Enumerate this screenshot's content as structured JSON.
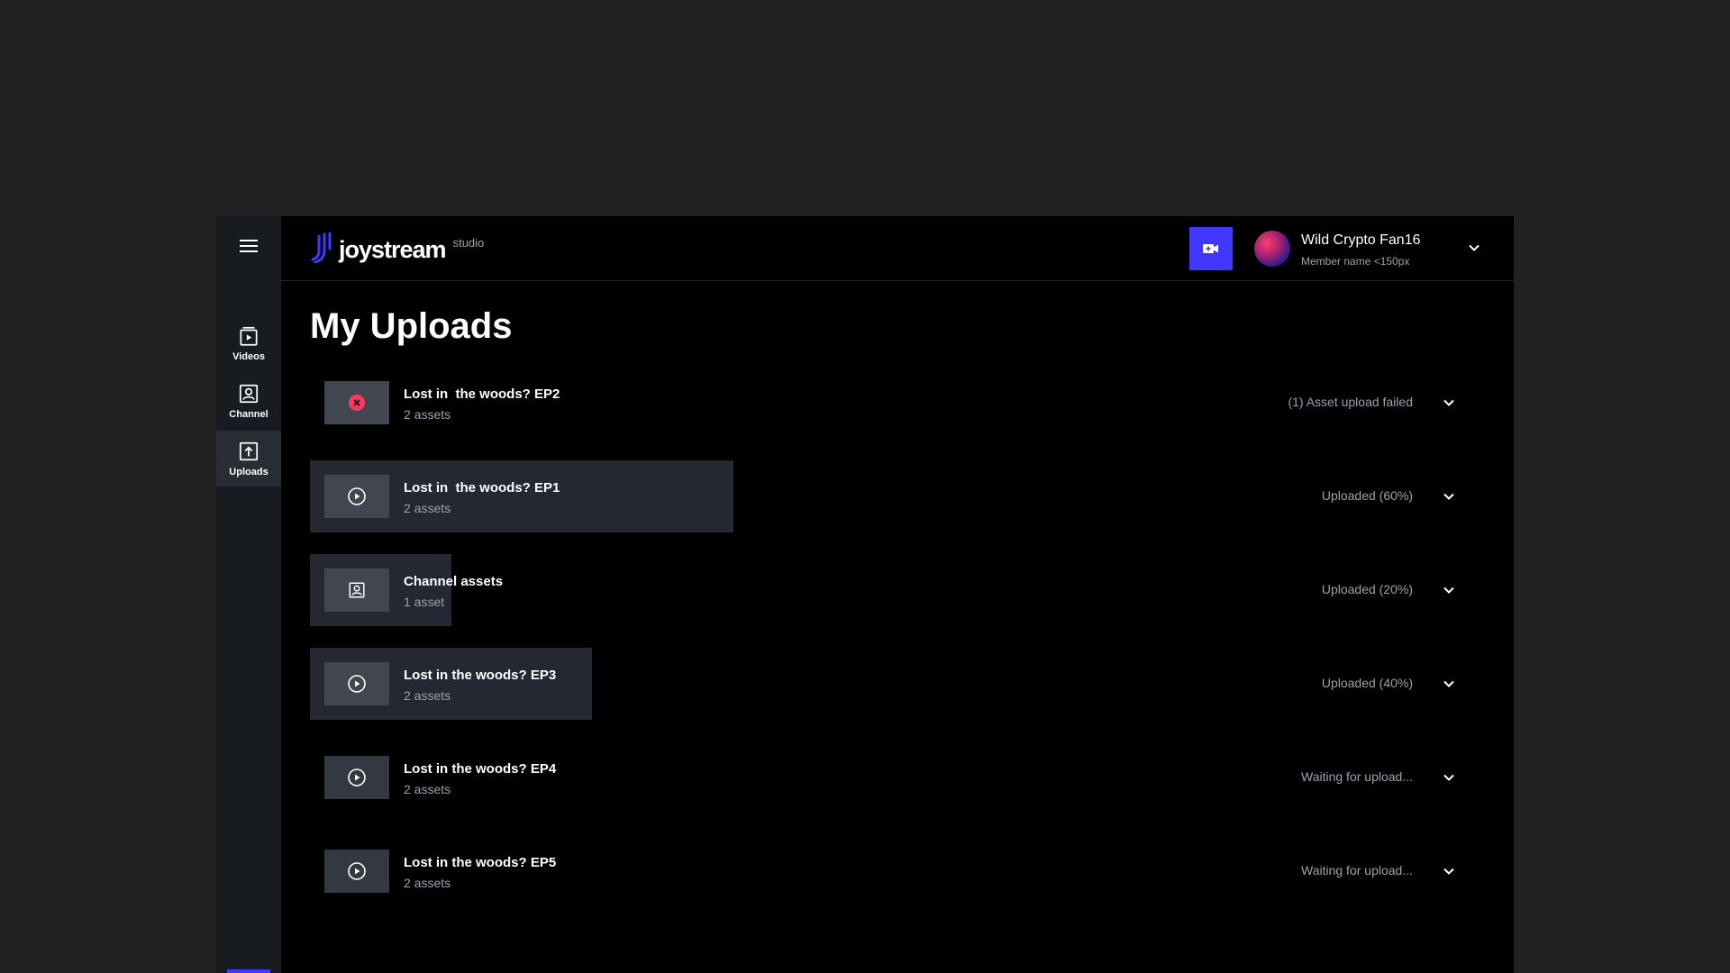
{
  "app": {
    "logo_text": "joystream",
    "logo_sub": "studio"
  },
  "colors": {
    "accent": "#4038ff",
    "error": "#ff3861",
    "background": "#000000",
    "sidebar": "#181c20",
    "progress_bar": "#252832"
  },
  "sidebar": {
    "menu_icon": "hamburger-menu-icon",
    "items": [
      {
        "label": "Videos",
        "icon": "video-icon",
        "active": false
      },
      {
        "label": "Channel",
        "icon": "channel-icon",
        "active": false
      },
      {
        "label": "Uploads",
        "icon": "upload-icon",
        "active": true
      }
    ]
  },
  "header": {
    "upload_button_icon": "add-video-icon",
    "member": {
      "name": "Wild Crypto Fan16",
      "subtitle": "Member name <150px"
    }
  },
  "page": {
    "title": "My Uploads"
  },
  "uploads": [
    {
      "title": "Lost in  the woods? EP2",
      "assets": "2 assets",
      "status": "(1) Asset upload failed",
      "progress": 0,
      "icon": "error-icon"
    },
    {
      "title": "Lost in  the woods? EP1",
      "assets": "2 assets",
      "status": "Uploaded (60%)",
      "progress": 0.6,
      "icon": "play-icon"
    },
    {
      "title": "Channel assets",
      "assets": "1 asset",
      "status": "Uploaded (20%)",
      "progress": 0.2,
      "icon": "channel-icon"
    },
    {
      "title": "Lost in the woods? EP3",
      "assets": "2 assets",
      "status": "Uploaded (40%)",
      "progress": 0.4,
      "icon": "play-icon"
    },
    {
      "title": "Lost in the woods? EP4",
      "assets": "2 assets",
      "status": "Waiting for upload...",
      "progress": 0,
      "icon": "play-icon"
    },
    {
      "title": "Lost in the woods? EP5",
      "assets": "2 assets",
      "status": "Waiting for upload...",
      "progress": 0,
      "icon": "play-icon"
    }
  ]
}
